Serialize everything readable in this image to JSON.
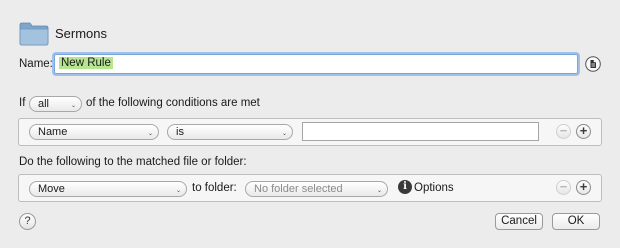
{
  "header": {
    "title": "Sermons",
    "icon": "folder-icon"
  },
  "name_row": {
    "label": "Name:",
    "value": "New Rule",
    "icon": "document-icon"
  },
  "conditions": {
    "prefix": "If",
    "match_selected": "all",
    "suffix": "of the following conditions are met",
    "criteria": [
      {
        "attribute": "Name",
        "operator": "is",
        "value": ""
      }
    ]
  },
  "actions": {
    "heading": "Do the following to the matched file or folder:",
    "items": [
      {
        "action": "Move",
        "to_folder_label": "to folder:",
        "folder_selected": "No folder selected",
        "options_label": "Options"
      }
    ]
  },
  "footer": {
    "help_label": "?",
    "cancel_label": "Cancel",
    "ok_label": "OK"
  },
  "glyphs": {
    "minus": "−",
    "plus": "+",
    "info": "i"
  },
  "colors": {
    "name_highlight": "#b5e58f",
    "focus_ring": "#9fc1ea",
    "background": "#ececec"
  }
}
